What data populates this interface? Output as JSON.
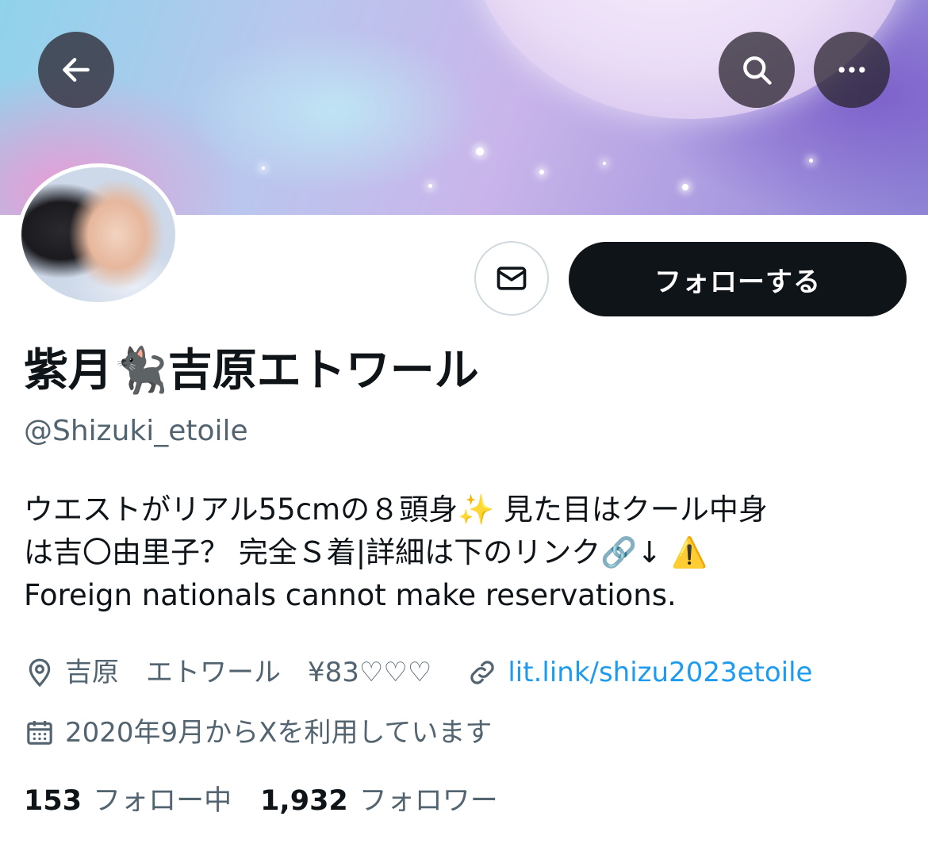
{
  "header": {
    "back_icon": "arrow-left-icon",
    "search_icon": "search-icon",
    "more_icon": "more-horizontal-icon"
  },
  "profile": {
    "display_name": "紫月🐈‍⬛吉原エトワール",
    "handle": "@Shizuki_etoile",
    "bio_lines": [
      "ウエストがリアル55cmの８頭身✨ 見た目はクール中身",
      "は吉〇由里子？ 完全Ｓ着|詳細は下のリンク🔗↓ ⚠️",
      "Foreign nationals cannot make reservations."
    ],
    "location": "吉原　エトワール　¥83♡♡♡",
    "link": "lit.link/shizu2023etoile",
    "joined": "2020年9月からXを利用しています"
  },
  "actions": {
    "message_icon": "mail-icon",
    "follow_label": "フォローする"
  },
  "stats": {
    "following_count": "153",
    "following_label": "フォロー中",
    "followers_count": "1,932",
    "followers_label": "フォロワー"
  },
  "colors": {
    "link": "#1d9bf0",
    "secondary_text": "#536471",
    "primary_text": "#0f1419",
    "follow_button_bg": "#0f1419"
  }
}
